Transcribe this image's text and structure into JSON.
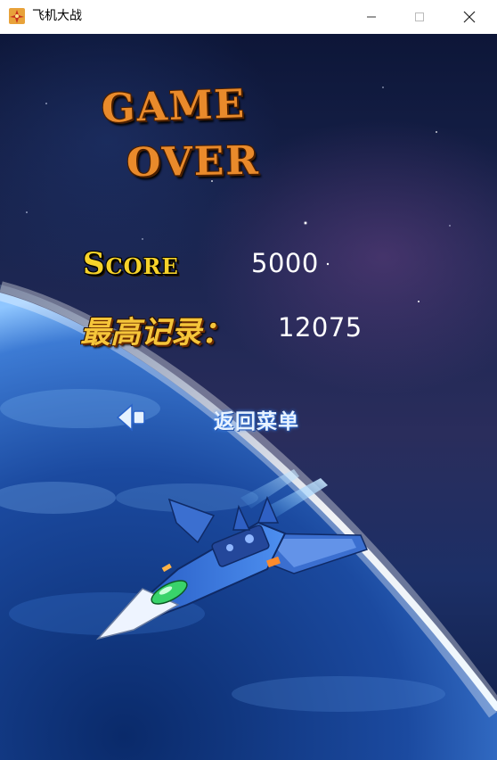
{
  "window": {
    "title": "飞机大战",
    "controls": [
      "minimize",
      "maximize",
      "close"
    ]
  },
  "game_over": {
    "line1": "GAME",
    "line2": "OVER"
  },
  "score": {
    "label": "Score",
    "value": "5000"
  },
  "record": {
    "label": "最高记录：",
    "value": "12075"
  },
  "menu": {
    "back_label": "返回菜单"
  },
  "icons": {
    "app": "plane-game-icon",
    "back": "back-arrow-icon",
    "player": "player-jet-sprite"
  },
  "colors": {
    "title_orange": "#e98a2b",
    "score_yellow": "#f6d22a",
    "record_gold": "#f5c53a",
    "sky_dark": "#0d1638"
  }
}
